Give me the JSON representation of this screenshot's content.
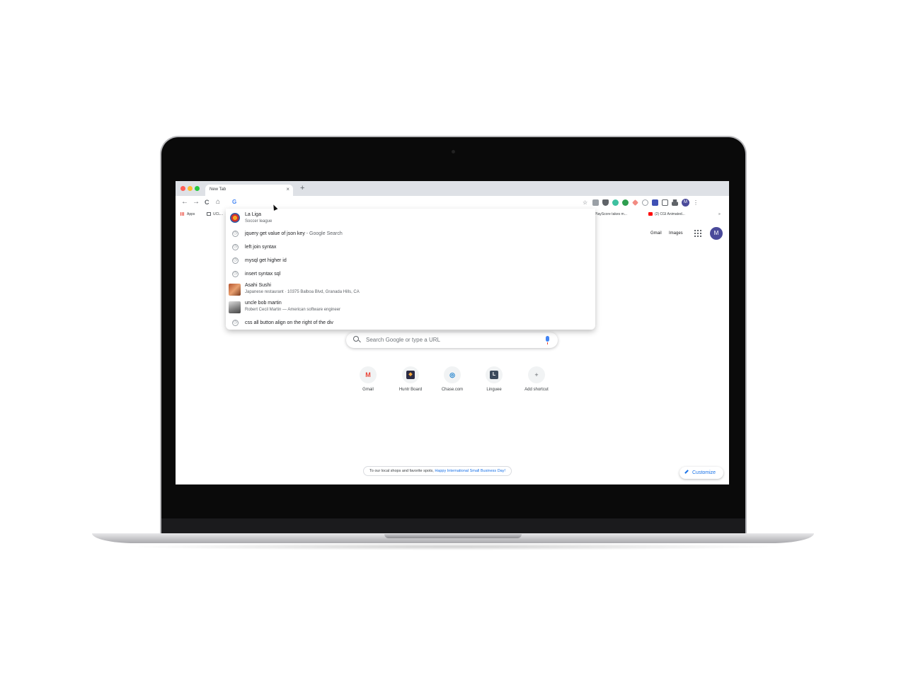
{
  "browser": {
    "tab_title": "New Tab",
    "tab_close": "×",
    "new_tab": "+",
    "omnibox_icon": "G",
    "profile_initial": "M",
    "menu": "⋮",
    "nav": {
      "back": "←",
      "forward": "→",
      "reload": "C",
      "home": "⌂"
    }
  },
  "bookmarks": {
    "apps": "Apps",
    "uc": "UCL...",
    "playscore": "PlayScore takes m...",
    "cgi": "(2) CGI Animated...",
    "more": "»"
  },
  "suggestions": [
    {
      "main": "La Liga",
      "sub": "Soccer league",
      "icon": "soccer-entity-icon"
    },
    {
      "main": "jquery get value of json key",
      "extra": " - Google Search",
      "icon": "history-icon"
    },
    {
      "main": "left join syntax",
      "icon": "history-icon"
    },
    {
      "main": "mysql get higher id",
      "icon": "history-icon"
    },
    {
      "main": "insert syntax sql",
      "icon": "history-icon"
    },
    {
      "main": "Asahi Sushi",
      "sub": "Japanese restaurant · 10375 Balboa Blvd, Granada Hills, CA",
      "icon": "restaurant-thumbnail"
    },
    {
      "main": "uncle bob martin",
      "sub": "Robert Cecil Martin — American software engineer",
      "icon": "person-thumbnail"
    },
    {
      "main": "css all button align on the right of the div",
      "icon": "history-icon"
    }
  ],
  "top_links": {
    "gmail": "Gmail",
    "images": "Images"
  },
  "search": {
    "placeholder": "Search Google or type a URL"
  },
  "shortcuts": [
    {
      "label": "Gmail",
      "glyph": "M"
    },
    {
      "label": "Huntr Board",
      "glyph": "◆"
    },
    {
      "label": "Chase.com",
      "glyph": "◎"
    },
    {
      "label": "Linguee",
      "glyph": "L"
    },
    {
      "label": "Add shortcut",
      "glyph": "+"
    }
  ],
  "footer": {
    "promo_text": "To our local shops and favorite spots, ",
    "promo_link": "Happy International Small Business Day!",
    "customize": "Customize"
  },
  "colors": {
    "accent": "#1a73e8",
    "avatar": "#4a4a9a",
    "tab_strip": "#dee1e6"
  }
}
